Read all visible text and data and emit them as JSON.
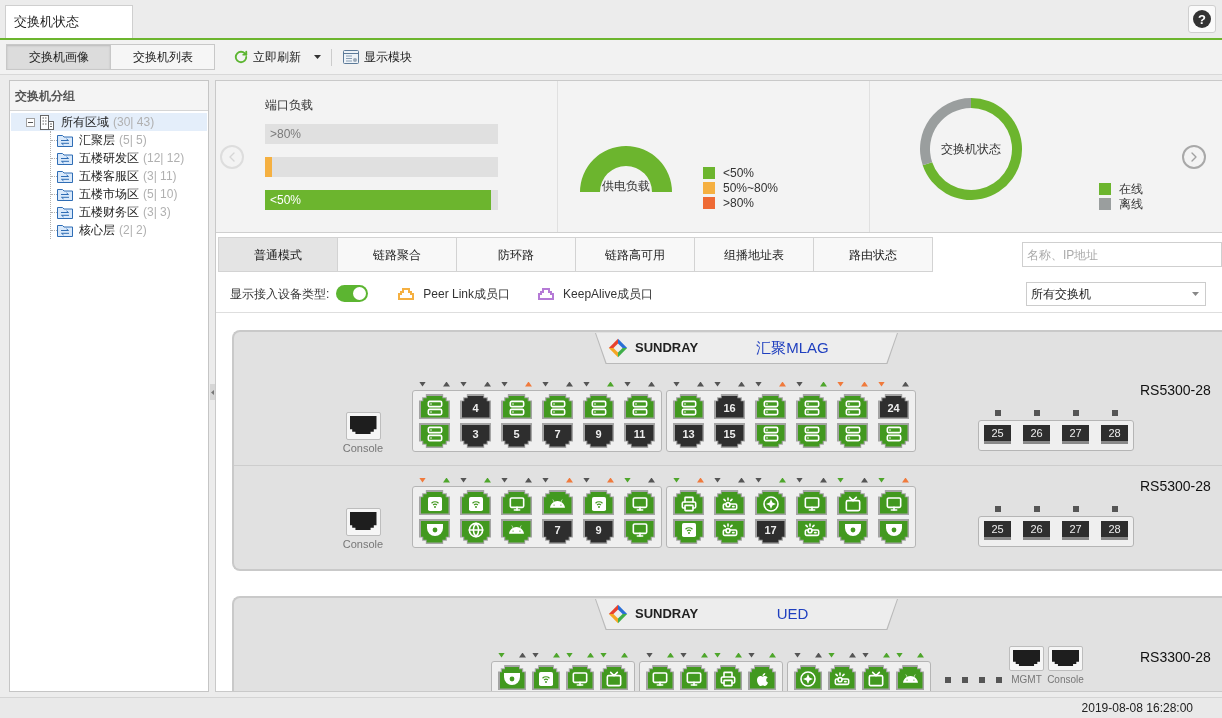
{
  "tabs": [
    {
      "label": "交换机状态",
      "selected": true
    }
  ],
  "help_button": {
    "label": "?"
  },
  "views": [
    {
      "label": "交换机画像",
      "selected": true
    },
    {
      "label": "交换机列表",
      "selected": false
    }
  ],
  "toolbar": [
    {
      "kind": "refresh",
      "label": "立即刷新"
    },
    {
      "kind": "modules",
      "label": "显示模块"
    }
  ],
  "sidebar": {
    "title": "交换机分组",
    "tree": [
      {
        "label": "所有区域",
        "count": "(30| 43)",
        "selected": true,
        "expanded": true,
        "children": [
          {
            "label": "汇聚层",
            "count": "(5| 5)",
            "selected": false
          },
          {
            "label": "五楼研发区",
            "count": "(12| 12)",
            "selected": false
          },
          {
            "label": "五楼客服区",
            "count": "(3| 11)",
            "selected": false
          },
          {
            "label": "五楼市场区",
            "count": "(5| 10)",
            "selected": false
          },
          {
            "label": "五楼财务区",
            "count": "(3| 3)",
            "selected": false
          },
          {
            "label": "核心层",
            "count": "(2| 2)",
            "selected": false
          }
        ]
      }
    ]
  },
  "summary": {
    "nav": [
      {
        "kind": "previous",
        "disabled": true
      },
      {
        "kind": "next",
        "disabled": false
      }
    ],
    "port_load": {
      "title": "端口负载",
      "bars": [
        {
          "label": ">80%"
        },
        {
          "color": "#f5b041",
          "level": 0.03
        },
        {
          "label": "<50%",
          "color": "#6cb52e",
          "level": 0.97
        }
      ]
    },
    "power_load": {
      "title": "供电负载",
      "legend": [
        {
          "label": "<50%",
          "color": "#6cb52e"
        },
        {
          "label": "50%~80%",
          "color": "#f5b041"
        },
        {
          "label": ">80%",
          "color": "#ee6a35"
        }
      ]
    },
    "switch_status": {
      "title": "交换机状态",
      "legend": [
        {
          "label": "在线",
          "color": "#6cb52e"
        },
        {
          "label": "离线",
          "color": "#9a9e9e"
        }
      ]
    }
  },
  "mode_tabs": [
    {
      "label": "普通模式",
      "selected": true
    },
    {
      "label": "链路聚合",
      "selected": false
    },
    {
      "label": "防环路",
      "selected": false
    },
    {
      "label": "链路高可用",
      "selected": false
    },
    {
      "label": "组播地址表",
      "selected": false
    },
    {
      "label": "路由状态",
      "selected": false
    }
  ],
  "search": {
    "placeholder": "名称、IP地址"
  },
  "filters": {
    "device_type": {
      "label": "显示接入设备类型:",
      "on": true
    },
    "legend": [
      {
        "label": "Peer Link成员口",
        "color": "#f5b041"
      },
      {
        "label": "KeepAlive成员口",
        "color": "#b57ad6"
      }
    ],
    "switch_select": {
      "value": "所有交换机"
    }
  },
  "device_groups": [
    {
      "brand": "SUNDRAY",
      "name": "汇聚MLAG",
      "switches": [
        {
          "kind": "standard",
          "model": "RS5300-28",
          "console": "Console",
          "blocks": [
            [
              {
                "leds": [
                  {
                    "kind": "down",
                    "color": "#555555"
                  },
                  {
                    "kind": "up",
                    "color": "#555555"
                  }
                ],
                "ports": [
                  {
                    "kind": "server"
                  },
                  {
                    "kind": "server"
                  }
                ]
              },
              {
                "leds": [
                  {
                    "kind": "down",
                    "color": "#555555"
                  },
                  {
                    "kind": "up",
                    "color": "#555555"
                  }
                ],
                "ports": [
                  {
                    "kind": "port",
                    "label": "4"
                  },
                  {
                    "kind": "port",
                    "label": "3"
                  }
                ]
              },
              {
                "leds": [
                  {
                    "kind": "down",
                    "color": "#555555"
                  },
                  {
                    "kind": "up",
                    "color": "#f07a3c"
                  }
                ],
                "ports": [
                  {
                    "kind": "server"
                  },
                  {
                    "kind": "port",
                    "label": "5"
                  }
                ]
              },
              {
                "leds": [
                  {
                    "kind": "down",
                    "color": "#555555"
                  },
                  {
                    "kind": "up",
                    "color": "#555555"
                  }
                ],
                "ports": [
                  {
                    "kind": "server"
                  },
                  {
                    "kind": "port",
                    "label": "7"
                  }
                ]
              },
              {
                "leds": [
                  {
                    "kind": "down",
                    "color": "#555555"
                  },
                  {
                    "kind": "up",
                    "color": "#4ea62b"
                  }
                ],
                "ports": [
                  {
                    "kind": "server"
                  },
                  {
                    "kind": "port",
                    "label": "9"
                  }
                ]
              },
              {
                "leds": [
                  {
                    "kind": "down",
                    "color": "#555555"
                  },
                  {
                    "kind": "up",
                    "color": "#555555"
                  }
                ],
                "ports": [
                  {
                    "kind": "server"
                  },
                  {
                    "kind": "port",
                    "label": "11"
                  }
                ]
              }
            ],
            [
              {
                "leds": [
                  {
                    "kind": "down",
                    "color": "#555555"
                  },
                  {
                    "kind": "up",
                    "color": "#555555"
                  }
                ],
                "ports": [
                  {
                    "kind": "server"
                  },
                  {
                    "kind": "port",
                    "label": "13"
                  }
                ]
              },
              {
                "leds": [
                  {
                    "kind": "down",
                    "color": "#555555"
                  },
                  {
                    "kind": "up",
                    "color": "#555555"
                  }
                ],
                "ports": [
                  {
                    "kind": "port",
                    "label": "16"
                  },
                  {
                    "kind": "port",
                    "label": "15"
                  }
                ]
              },
              {
                "leds": [
                  {
                    "kind": "down",
                    "color": "#555555"
                  },
                  {
                    "kind": "up",
                    "color": "#f07a3c"
                  }
                ],
                "ports": [
                  {
                    "kind": "server"
                  },
                  {
                    "kind": "server"
                  }
                ]
              },
              {
                "leds": [
                  {
                    "kind": "down",
                    "color": "#555555"
                  },
                  {
                    "kind": "up",
                    "color": "#4ea62b"
                  }
                ],
                "ports": [
                  {
                    "kind": "server"
                  },
                  {
                    "kind": "server"
                  }
                ]
              },
              {
                "leds": [
                  {
                    "kind": "down",
                    "color": "#f07a3c"
                  },
                  {
                    "kind": "up",
                    "color": "#f07a3c"
                  }
                ],
                "ports": [
                  {
                    "kind": "server"
                  },
                  {
                    "kind": "server"
                  }
                ]
              },
              {
                "leds": [
                  {
                    "kind": "down",
                    "color": "#f07a3c"
                  },
                  {
                    "kind": "up",
                    "color": "#555555"
                  }
                ],
                "ports": [
                  {
                    "kind": "port",
                    "label": "24"
                  },
                  {
                    "kind": "server"
                  }
                ]
              }
            ]
          ],
          "sfp": [
            {
              "label": "25"
            },
            {
              "label": "26"
            },
            {
              "label": "27"
            },
            {
              "label": "28"
            }
          ]
        },
        {
          "kind": "standard",
          "model": "RS5300-28",
          "console": "Console",
          "blocks": [
            [
              {
                "leds": [
                  {
                    "kind": "down",
                    "color": "#f07a3c"
                  },
                  {
                    "kind": "up",
                    "color": "#4ea62b"
                  }
                ],
                "ports": [
                  {
                    "kind": "wifi"
                  },
                  {
                    "kind": "camera"
                  }
                ]
              },
              {
                "leds": [
                  {
                    "kind": "down",
                    "color": "#555555"
                  },
                  {
                    "kind": "up",
                    "color": "#4ea62b"
                  }
                ],
                "ports": [
                  {
                    "kind": "wifi"
                  },
                  {
                    "kind": "globe"
                  }
                ]
              },
              {
                "leds": [
                  {
                    "kind": "down",
                    "color": "#555555"
                  },
                  {
                    "kind": "up",
                    "color": "#555555"
                  }
                ],
                "ports": [
                  {
                    "kind": "monitor"
                  },
                  {
                    "kind": "android"
                  }
                ]
              },
              {
                "leds": [
                  {
                    "kind": "down",
                    "color": "#555555"
                  },
                  {
                    "kind": "up",
                    "color": "#f07a3c"
                  }
                ],
                "ports": [
                  {
                    "kind": "android"
                  },
                  {
                    "kind": "port",
                    "label": "7"
                  }
                ]
              },
              {
                "leds": [
                  {
                    "kind": "down",
                    "color": "#555555"
                  },
                  {
                    "kind": "up",
                    "color": "#f07a3c"
                  }
                ],
                "ports": [
                  {
                    "kind": "wifi"
                  },
                  {
                    "kind": "port",
                    "label": "9"
                  }
                ]
              },
              {
                "leds": [
                  {
                    "kind": "down",
                    "color": "#4ea62b"
                  },
                  {
                    "kind": "up",
                    "color": "#555555"
                  }
                ],
                "ports": [
                  {
                    "kind": "monitor"
                  },
                  {
                    "kind": "monitor"
                  }
                ]
              }
            ],
            [
              {
                "leds": [
                  {
                    "kind": "down",
                    "color": "#4ea62b"
                  },
                  {
                    "kind": "up",
                    "color": "#f07a3c"
                  }
                ],
                "ports": [
                  {
                    "kind": "printer"
                  },
                  {
                    "kind": "wifi"
                  }
                ]
              },
              {
                "leds": [
                  {
                    "kind": "down",
                    "color": "#555555"
                  },
                  {
                    "kind": "up",
                    "color": "#555555"
                  }
                ],
                "ports": [
                  {
                    "kind": "projector"
                  },
                  {
                    "kind": "projector"
                  }
                ]
              },
              {
                "leds": [
                  {
                    "kind": "down",
                    "color": "#555555"
                  },
                  {
                    "kind": "up",
                    "color": "#4ea62b"
                  }
                ],
                "ports": [
                  {
                    "kind": "ap"
                  },
                  {
                    "kind": "port",
                    "label": "17"
                  }
                ]
              },
              {
                "leds": [
                  {
                    "kind": "down",
                    "color": "#555555"
                  },
                  {
                    "kind": "up",
                    "color": "#555555"
                  }
                ],
                "ports": [
                  {
                    "kind": "monitor"
                  },
                  {
                    "kind": "projector"
                  }
                ]
              },
              {
                "leds": [
                  {
                    "kind": "down",
                    "color": "#4ea62b"
                  },
                  {
                    "kind": "up",
                    "color": "#555555"
                  }
                ],
                "ports": [
                  {
                    "kind": "tv"
                  },
                  {
                    "kind": "camera"
                  }
                ]
              },
              {
                "leds": [
                  {
                    "kind": "down",
                    "color": "#4ea62b"
                  },
                  {
                    "kind": "up",
                    "color": "#f07a3c"
                  }
                ],
                "ports": [
                  {
                    "kind": "monitor"
                  },
                  {
                    "kind": "camera"
                  }
                ]
              }
            ]
          ],
          "sfp": [
            {
              "label": "25"
            },
            {
              "label": "26"
            },
            {
              "label": "27"
            },
            {
              "label": "28"
            }
          ]
        }
      ]
    },
    {
      "brand": "SUNDRAY",
      "name": "UED",
      "switches": [
        {
          "kind": "compact",
          "model": "RS3300-28",
          "blocks": [
            [
              {
                "leds": [
                  {
                    "kind": "down",
                    "color": "#4ea62b"
                  },
                  {
                    "kind": "up",
                    "color": "#555555"
                  }
                ],
                "ports": [
                  {
                    "kind": "camera"
                  }
                ]
              },
              {
                "leds": [
                  {
                    "kind": "down",
                    "color": "#555555"
                  },
                  {
                    "kind": "up",
                    "color": "#4ea62b"
                  }
                ],
                "ports": [
                  {
                    "kind": "wifi"
                  }
                ]
              },
              {
                "leds": [
                  {
                    "kind": "down",
                    "color": "#4ea62b"
                  },
                  {
                    "kind": "up",
                    "color": "#4ea62b"
                  }
                ],
                "ports": [
                  {
                    "kind": "monitor"
                  }
                ]
              },
              {
                "leds": [
                  {
                    "kind": "down",
                    "color": "#4ea62b"
                  },
                  {
                    "kind": "up",
                    "color": "#4ea62b"
                  }
                ],
                "ports": [
                  {
                    "kind": "tv"
                  }
                ]
              }
            ],
            [
              {
                "leds": [
                  {
                    "kind": "down",
                    "color": "#555555"
                  },
                  {
                    "kind": "up",
                    "color": "#4ea62b"
                  }
                ],
                "ports": [
                  {
                    "kind": "monitor"
                  }
                ]
              },
              {
                "leds": [
                  {
                    "kind": "down",
                    "color": "#555555"
                  },
                  {
                    "kind": "up",
                    "color": "#4ea62b"
                  }
                ],
                "ports": [
                  {
                    "kind": "monitor"
                  }
                ]
              },
              {
                "leds": [
                  {
                    "kind": "down",
                    "color": "#4ea62b"
                  },
                  {
                    "kind": "up",
                    "color": "#4ea62b"
                  }
                ],
                "ports": [
                  {
                    "kind": "printer"
                  }
                ]
              },
              {
                "leds": [
                  {
                    "kind": "down",
                    "color": "#555555"
                  },
                  {
                    "kind": "up",
                    "color": "#4ea62b"
                  }
                ],
                "ports": [
                  {
                    "kind": "apple"
                  }
                ]
              }
            ],
            [
              {
                "leds": [
                  {
                    "kind": "down",
                    "color": "#555555"
                  },
                  {
                    "kind": "up",
                    "color": "#555555"
                  }
                ],
                "ports": [
                  {
                    "kind": "ap"
                  }
                ]
              },
              {
                "leds": [
                  {
                    "kind": "down",
                    "color": "#4ea62b"
                  },
                  {
                    "kind": "up",
                    "color": "#555555"
                  }
                ],
                "ports": [
                  {
                    "kind": "projector"
                  }
                ]
              },
              {
                "leds": [
                  {
                    "kind": "down",
                    "color": "#555555"
                  },
                  {
                    "kind": "up",
                    "color": "#4ea62b"
                  }
                ],
                "ports": [
                  {
                    "kind": "tv"
                  }
                ]
              },
              {
                "leds": [
                  {
                    "kind": "down",
                    "color": "#4ea62b"
                  },
                  {
                    "kind": "up",
                    "color": "#4ea62b"
                  }
                ],
                "ports": [
                  {
                    "kind": "android"
                  }
                ]
              }
            ]
          ],
          "mgmt_ports": [
            {
              "label": "MGMT"
            },
            {
              "label": "Console"
            }
          ]
        }
      ]
    }
  ],
  "status_bar": {
    "time": "2019-08-08 16:28:00"
  }
}
